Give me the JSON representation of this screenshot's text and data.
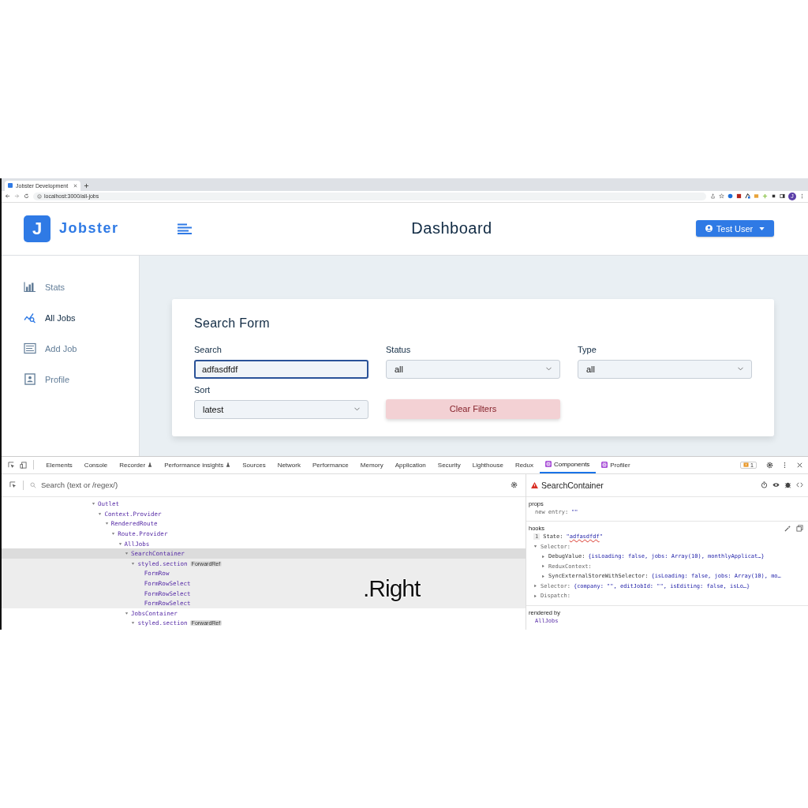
{
  "browser": {
    "tab_title": "Jobster Development",
    "url": "localhost:3000/all-jobs",
    "avatar_letter": "J"
  },
  "app": {
    "logo_letter": "J",
    "logo_text": "Jobster",
    "page_title": "Dashboard",
    "user_button": "Test User",
    "sidebar": [
      {
        "label": "Stats",
        "selected": false
      },
      {
        "label": "All Jobs",
        "selected": true
      },
      {
        "label": "Add Job",
        "selected": false
      },
      {
        "label": "Profile",
        "selected": false
      }
    ],
    "form": {
      "title": "Search Form",
      "fields": [
        {
          "kind": "input",
          "label": "Search",
          "value": "adfasdfdf",
          "focused": true
        },
        {
          "kind": "select",
          "label": "Status",
          "value": "all",
          "focused": false
        },
        {
          "kind": "select",
          "label": "Type",
          "value": "all",
          "focused": false
        },
        {
          "kind": "select",
          "label": "Sort",
          "value": "latest",
          "focused": false
        }
      ],
      "clear_button": "Clear Filters"
    }
  },
  "devtools": {
    "tabs": [
      {
        "label": "Elements",
        "kind": "plain",
        "selected": false
      },
      {
        "label": "Console",
        "kind": "plain",
        "selected": false
      },
      {
        "label": "Recorder",
        "kind": "experimental",
        "selected": false
      },
      {
        "label": "Performance insights",
        "kind": "experimental",
        "selected": false
      },
      {
        "label": "Sources",
        "kind": "plain",
        "selected": false
      },
      {
        "label": "Network",
        "kind": "plain",
        "selected": false
      },
      {
        "label": "Performance",
        "kind": "plain",
        "selected": false
      },
      {
        "label": "Memory",
        "kind": "plain",
        "selected": false
      },
      {
        "label": "Application",
        "kind": "plain",
        "selected": false
      },
      {
        "label": "Security",
        "kind": "plain",
        "selected": false
      },
      {
        "label": "Lighthouse",
        "kind": "plain",
        "selected": false
      },
      {
        "label": "Redux",
        "kind": "plain",
        "selected": false
      },
      {
        "label": "Components",
        "kind": "react",
        "selected": true
      },
      {
        "label": "Profiler",
        "kind": "react",
        "selected": false
      }
    ],
    "issues_count": "1",
    "search": {
      "placeholder": "Search (text or /regex/)"
    },
    "tree": [
      {
        "name": "Outlet",
        "expanded": true,
        "selected": false,
        "children": [
          {
            "name": "Context.Provider",
            "expanded": true,
            "selected": false,
            "children": [
              {
                "name": "RenderedRoute",
                "expanded": true,
                "selected": false,
                "children": [
                  {
                    "name": "Route.Provider",
                    "expanded": true,
                    "selected": false,
                    "children": [
                      {
                        "name": "AllJobs",
                        "expanded": true,
                        "selected": false,
                        "children": [
                          {
                            "name": "SearchContainer",
                            "expanded": true,
                            "selected": true,
                            "children": [
                              {
                                "name": "styled.section",
                                "badge": "ForwardRef",
                                "expanded": true,
                                "selected": false,
                                "children": [
                                  {
                                    "name": "FormRow",
                                    "selected": false
                                  },
                                  {
                                    "name": "FormRowSelect",
                                    "selected": false
                                  },
                                  {
                                    "name": "FormRowSelect",
                                    "selected": false
                                  },
                                  {
                                    "name": "FormRowSelect",
                                    "selected": false
                                  }
                                ]
                              }
                            ]
                          },
                          {
                            "name": "JobsContainer",
                            "expanded": true,
                            "selected": false,
                            "children": [
                              {
                                "name": "styled.section",
                                "badge": "ForwardRef",
                                "expanded": true,
                                "selected": false
                              }
                            ]
                          }
                        ]
                      }
                    ]
                  }
                ]
              }
            ]
          }
        ]
      }
    ],
    "inspector": {
      "component": "SearchContainer",
      "props_title": "props",
      "props": [
        {
          "key": "new entry:",
          "value": "\"\""
        }
      ],
      "hooks_title": "hooks",
      "hooks": [
        {
          "kind": "state",
          "index": "1",
          "key": "State:",
          "value": "\"adfasdfdf\""
        },
        {
          "kind": "node",
          "key": "Selector:",
          "expanded": true,
          "children": [
            {
              "kind": "node",
              "key": "DebugValue:",
              "value": "{isLoading: false, jobs: Array(10), monthlyApplicat…}",
              "expanded": false
            },
            {
              "kind": "node",
              "key": "ReduxContext:",
              "expanded": false
            },
            {
              "kind": "node",
              "key": "SyncExternalStoreWithSelector:",
              "value": "{isLoading: false, jobs: Array(10), mo…",
              "expanded": false
            }
          ]
        },
        {
          "kind": "node",
          "key": "Selector:",
          "value": "{company: \"\", editJobId: \"\", isEditing: false, isLo…}",
          "expanded": false
        },
        {
          "kind": "node",
          "key": "Dispatch:",
          "expanded": false
        }
      ],
      "rendered_by_title": "rendered by",
      "rendered_by": "AllJobs"
    }
  },
  "caption": ".Right"
}
